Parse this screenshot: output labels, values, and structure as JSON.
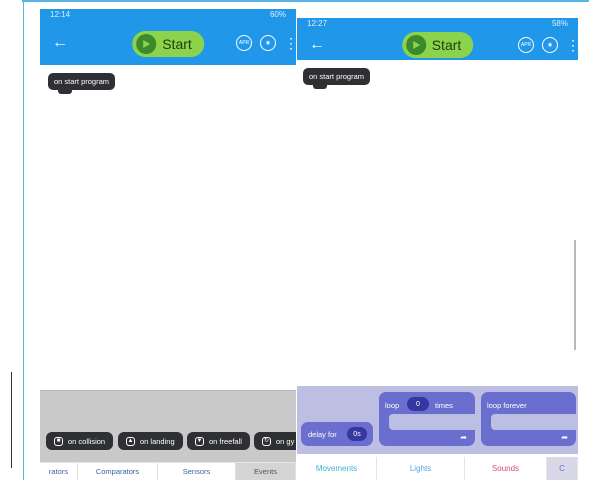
{
  "colors": {
    "appbar": "#2197ea",
    "start_button": "#8bd34a",
    "block_dark": "#2f3033",
    "block_purple": "#6a6fcf",
    "toolbox_grey": "#c9c9c9",
    "toolbox_purple": "#bcbfe1",
    "tab_movements": "#3ab7d6",
    "tab_lights": "#5aa8d8",
    "tab_sounds": "#d64a7e",
    "tab_text_left": "#3a63a6"
  },
  "screen_left": {
    "status": {
      "time": "12:14",
      "battery": "60%"
    },
    "appbar": {
      "back_icon": "arrow-left",
      "start_label": "Start",
      "icons": [
        "apr-icon",
        "eye-icon",
        "kebab-menu-icon"
      ],
      "apr_text": "APR"
    },
    "canvas": {
      "event_block": "on start program"
    },
    "toolbox": {
      "blocks": [
        {
          "label": "on collision",
          "icon": "collision-icon"
        },
        {
          "label": "on landing",
          "icon": "landing-icon"
        },
        {
          "label": "on freefall",
          "icon": "freefall-icon"
        },
        {
          "label": "on gy",
          "icon": "gyro-icon"
        }
      ]
    },
    "tabs": [
      {
        "label": "rators",
        "active": false
      },
      {
        "label": "Comparators",
        "active": false
      },
      {
        "label": "Sensors",
        "active": false
      },
      {
        "label": "Events",
        "active": true
      }
    ]
  },
  "screen_right": {
    "status": {
      "time": "12:27",
      "battery": "58%"
    },
    "appbar": {
      "back_icon": "arrow-left",
      "start_label": "Start",
      "icons": [
        "apr-icon",
        "eye-icon",
        "kebab-menu-icon"
      ],
      "apr_text": "APR"
    },
    "canvas": {
      "event_block": "on start program"
    },
    "toolbox": {
      "delay": {
        "label": "delay for",
        "value": "0s"
      },
      "loop": {
        "label": "loop",
        "value": "0",
        "suffix": "times"
      },
      "loop_forever": {
        "label": "loop forever"
      }
    },
    "tabs": [
      {
        "label": "Movements",
        "active": false
      },
      {
        "label": "Lights",
        "active": false
      },
      {
        "label": "Sounds",
        "active": false
      },
      {
        "label": "C",
        "active": true
      }
    ]
  }
}
